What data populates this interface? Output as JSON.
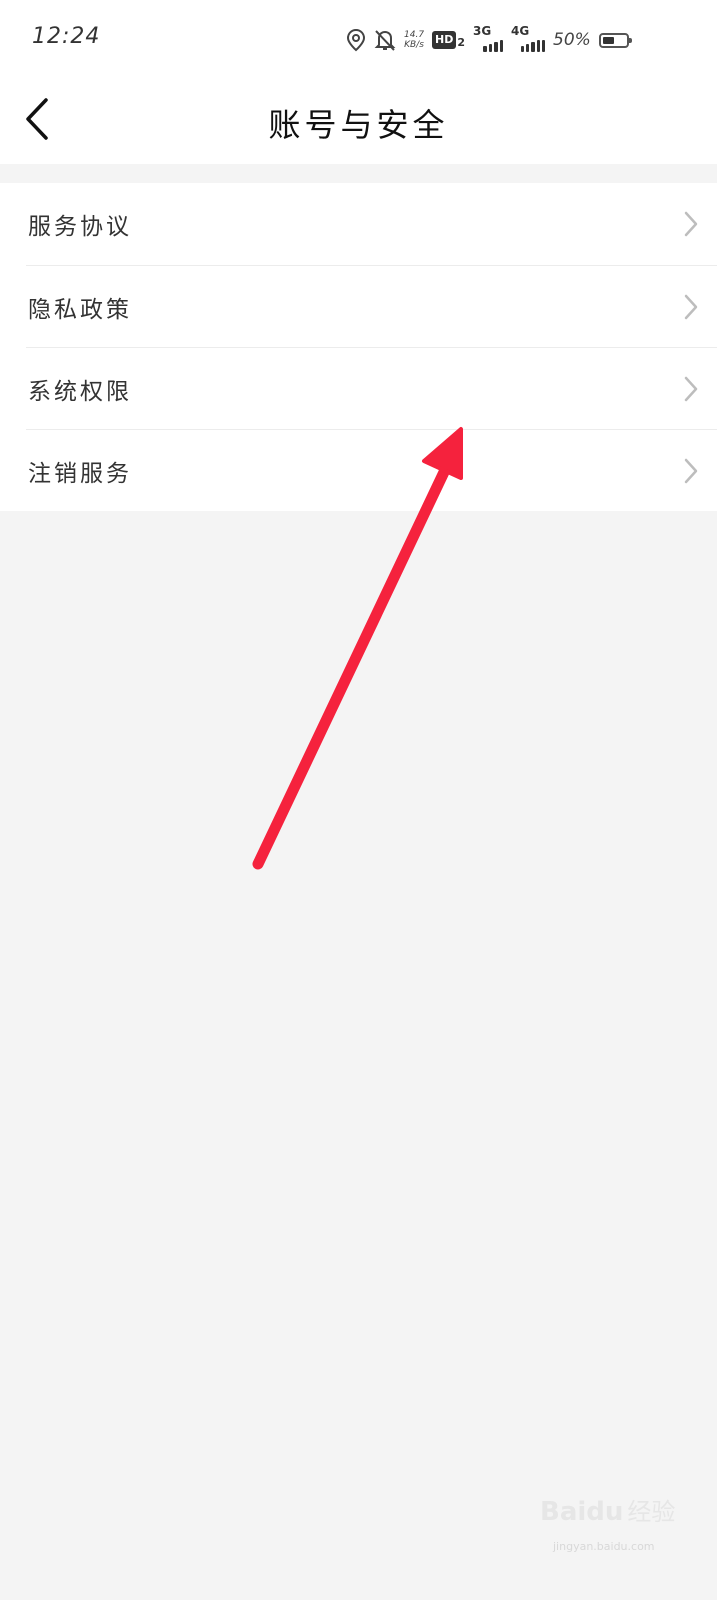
{
  "status_bar": {
    "time": "12:24",
    "net_speed_value": "14.7",
    "net_speed_unit": "KB/s",
    "hd_label": "HD",
    "hd_sub": "2",
    "sig1_label": "3G",
    "sig2_label": "4G",
    "battery_percent": "50%",
    "battery_level": 0.5,
    "icons": [
      "location-icon",
      "alarm-off-icon"
    ]
  },
  "header": {
    "title": "账号与安全"
  },
  "menu": {
    "items": [
      {
        "label": "服务协议"
      },
      {
        "label": "隐私政策"
      },
      {
        "label": "系统权限"
      },
      {
        "label": "注销服务"
      }
    ]
  },
  "annotation": {
    "arrow_color": "#f5223d"
  },
  "watermark": {
    "logo": "Baidu",
    "text": "经验",
    "url": "jingyan.baidu.com"
  }
}
